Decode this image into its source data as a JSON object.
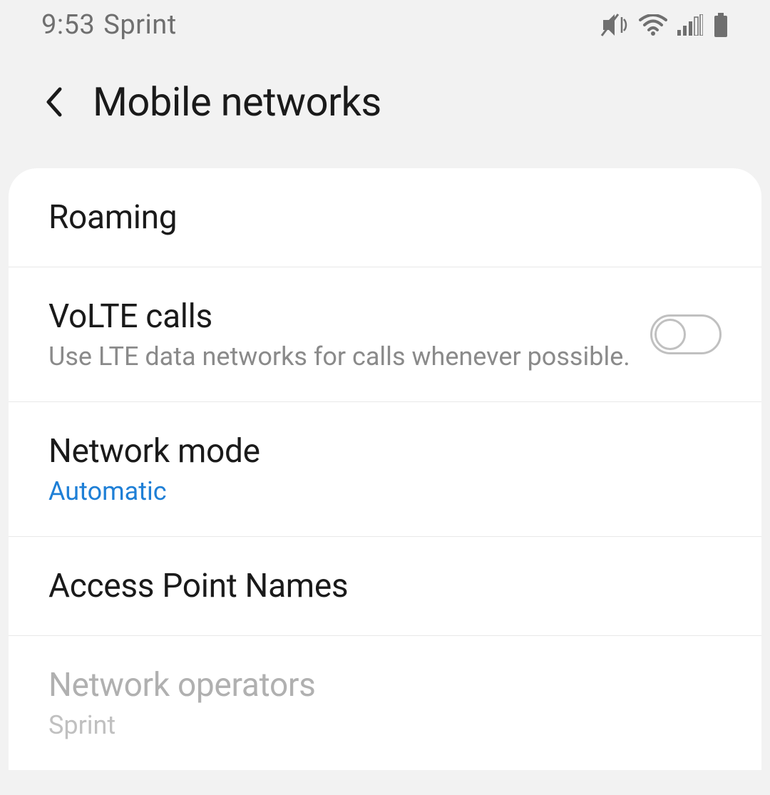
{
  "status_bar": {
    "time": "9:53",
    "carrier": "Sprint"
  },
  "header": {
    "title": "Mobile networks"
  },
  "items": [
    {
      "title": "Roaming"
    },
    {
      "title": "VoLTE calls",
      "subtitle": "Use LTE data networks for calls whenever possible."
    },
    {
      "title": "Network mode",
      "value": "Automatic"
    },
    {
      "title": "Access Point Names"
    },
    {
      "title": "Network operators",
      "subtitle": "Sprint"
    }
  ]
}
